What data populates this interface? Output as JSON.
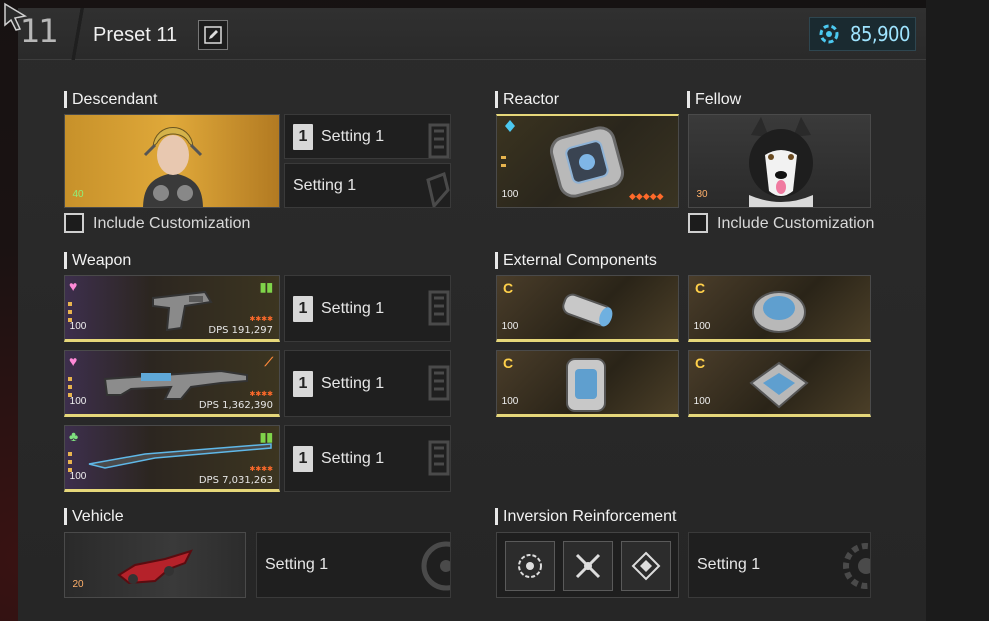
{
  "header": {
    "preset_number": "11",
    "preset_name": "Preset 11",
    "currency_amount": "85,900"
  },
  "sections": {
    "descendant": "Descendant",
    "reactor": "Reactor",
    "fellow": "Fellow",
    "weapon": "Weapon",
    "external_components": "External Components",
    "vehicle": "Vehicle",
    "inversion": "Inversion Reinforcement"
  },
  "descendant": {
    "level": "40",
    "setting_primary": "Setting 1",
    "setting_secondary": "Setting 1",
    "include_label": "Include Customization",
    "include_checked": false
  },
  "reactor": {
    "level": "100"
  },
  "fellow": {
    "level": "30",
    "include_label": "Include Customization",
    "include_checked": false
  },
  "weapons": [
    {
      "level": "100",
      "dps": "DPS 191,297",
      "setting": "Setting 1",
      "suit": "♥",
      "suit_color": "#ff8ad8"
    },
    {
      "level": "100",
      "dps": "DPS 1,362,390",
      "setting": "Setting 1",
      "suit": "♥",
      "suit_color": "#ff8ad8"
    },
    {
      "level": "100",
      "dps": "DPS 7,031,263",
      "setting": "Setting 1",
      "suit": "♣",
      "suit_color": "#7fe07f"
    }
  ],
  "external_components": [
    {
      "level": "100",
      "grade": "C"
    },
    {
      "level": "100",
      "grade": "C"
    },
    {
      "level": "100",
      "grade": "C"
    },
    {
      "level": "100",
      "grade": "C"
    }
  ],
  "vehicle": {
    "level": "20",
    "setting": "Setting 1"
  },
  "inversion": {
    "setting": "Setting 1"
  },
  "setting_badge": "1",
  "colors": {
    "accent_gold": "#e6d77a",
    "currency_blue": "#9fe4ff",
    "star_orange": "#ff6a2a"
  }
}
